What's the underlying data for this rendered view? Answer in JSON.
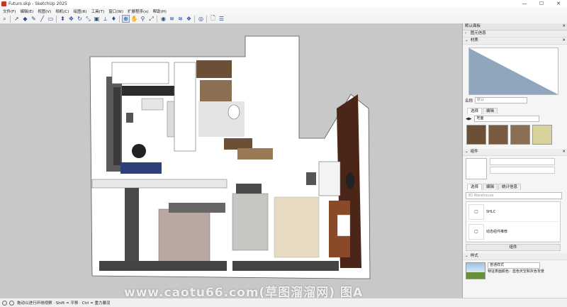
{
  "window": {
    "title": "Futuro.skp - SketchUp 2025",
    "min": "—",
    "max": "☐",
    "close": "✕"
  },
  "menu": [
    "文件(F)",
    "编辑(E)",
    "视图(V)",
    "相机(C)",
    "绘图(R)",
    "工具(T)",
    "窗口(W)",
    "扩展程序(x)",
    "帮助(H)"
  ],
  "toolbar_icons": [
    "search-icon",
    "select-icon",
    "eraser-icon",
    "pencil-icon",
    "line-icon",
    "rectangle-icon",
    "push-pull-icon",
    "move-icon",
    "rotate-icon",
    "scale-icon",
    "offset-icon",
    "tape-icon",
    "paint-icon",
    "orbit-icon",
    "pan-icon",
    "zoom-icon",
    "zoom-extents-icon",
    "section-icon",
    "3d-warehouse-icon",
    "extension-icon",
    "components-icon",
    "styles-icon",
    "new-file-icon",
    "settings-icon"
  ],
  "panel": {
    "title": "默认面板",
    "sections": {
      "entity_info": "图元信息",
      "materials": "材质",
      "components": "组件",
      "styles": "样式"
    },
    "materials": {
      "name_label": "名称",
      "name_value": "默认",
      "tab_select": "选择",
      "tab_edit": "编辑",
      "library": "地面",
      "swatch_colors": [
        "#6b5035",
        "#7a5a3e",
        "#8a6f52",
        "#d8d39a"
      ]
    },
    "components": {
      "tab_select": "选择",
      "tab_edit": "编辑",
      "tab_stats": "统计信息",
      "search_placeholder": "3D Warehouse",
      "items": [
        "SHLC",
        "动态组件推荐"
      ],
      "footer": "组件"
    },
    "styles": {
      "name": "普通样式",
      "desc": "特征表面颜色：蓝色天空和灰色背景"
    }
  },
  "status": {
    "hint": "拖动以进行环绕视察 · Shift = 平移 · Ctrl = 重力暴没"
  },
  "watermark": "www.caotu66.com(草图溜溜网) 图A"
}
